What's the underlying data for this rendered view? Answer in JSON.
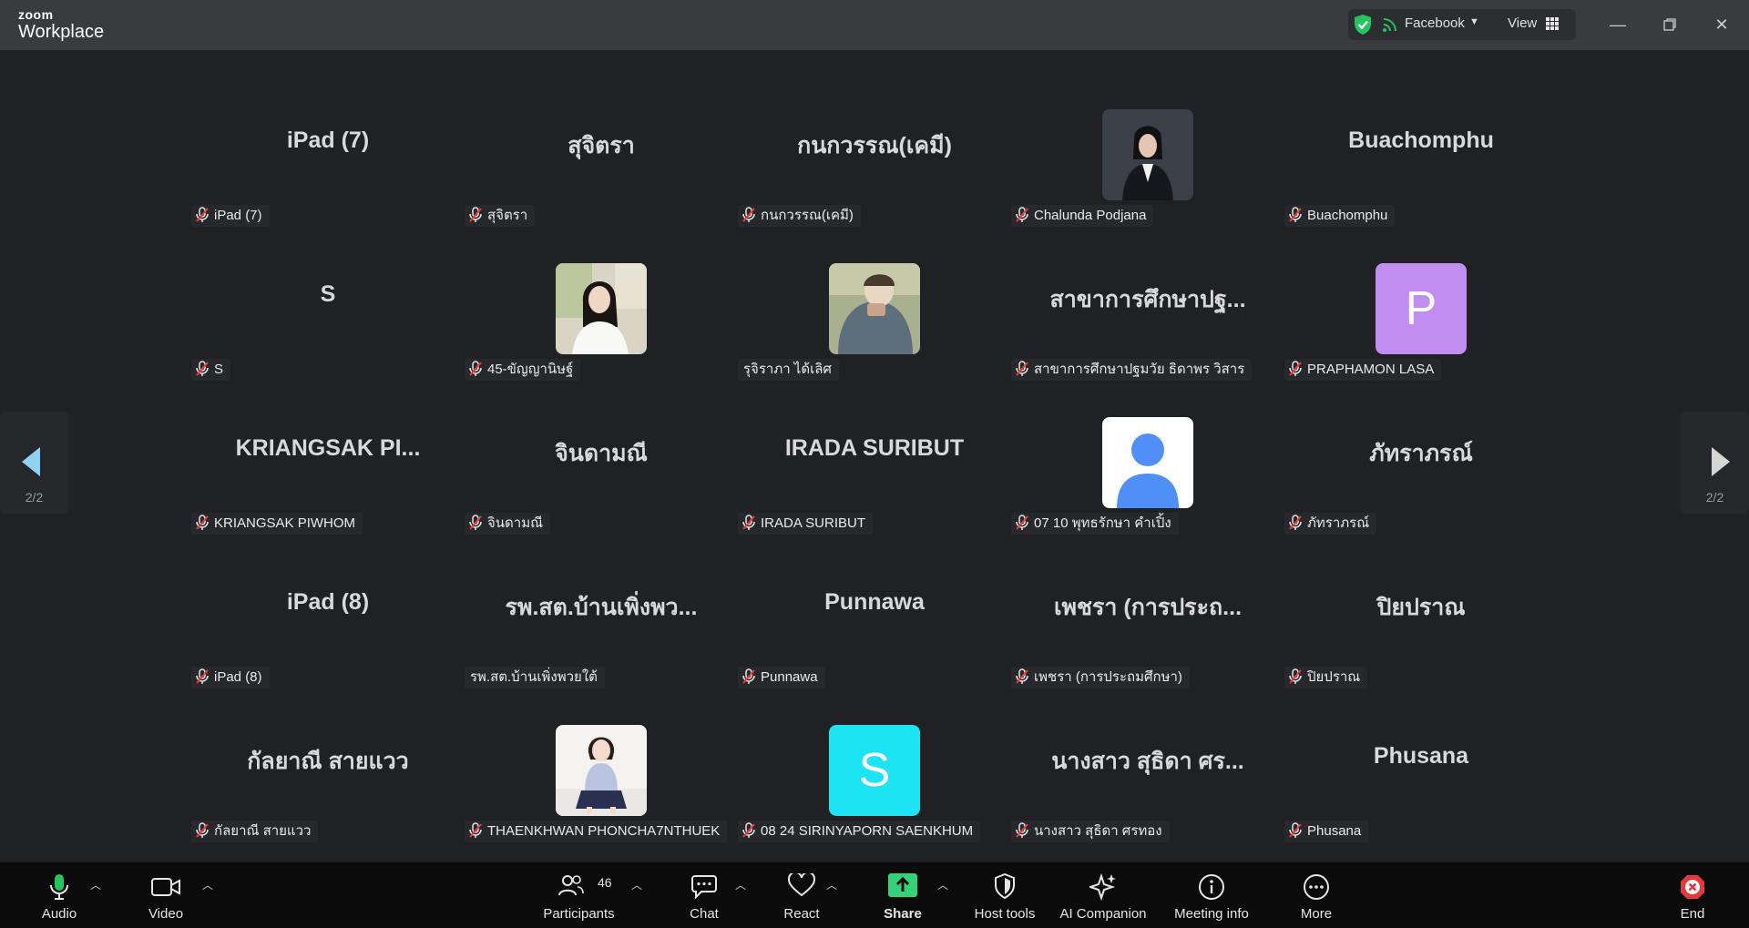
{
  "window": {
    "brand_small": "zoom",
    "brand_large": "Workplace",
    "share_source": "Facebook",
    "view_label": "View"
  },
  "gallery": {
    "page_indicator_left": "2/2",
    "page_indicator_right": "2/2",
    "tiles": [
      {
        "display": "iPad (7)",
        "label": "iPad (7)",
        "muted": true
      },
      {
        "display": "สุจิตรา",
        "label": "สุจิตรา",
        "muted": true
      },
      {
        "display": "กนกวรรณ(เคมี)",
        "label": "กนกวรรณ(เคมี)",
        "muted": true
      },
      {
        "display": "",
        "label": "Chalunda Podjana",
        "muted": true,
        "avatar": "photo-portrait-dark"
      },
      {
        "display": "Buachomphu",
        "label": "Buachomphu",
        "muted": true
      },
      {
        "display": "S",
        "label": "S",
        "muted": true
      },
      {
        "display": "",
        "label": "45-ขัญญานิษฐ์",
        "muted": true,
        "avatar": "photo-woman-white-shirt"
      },
      {
        "display": "",
        "label": "รุจิราภา ได้เลิศ",
        "muted": false,
        "avatar": "photo-person-outdoor"
      },
      {
        "display": "สาขาการศึกษาปฐ...",
        "label": "สาขาการศึกษาปฐมวัย ธิดาพร วิสาร",
        "muted": true
      },
      {
        "display": "",
        "label": "PRAPHAMON LASA",
        "muted": true,
        "avatar": "letter",
        "letter": "P",
        "avatar_color": "#c18df0"
      },
      {
        "display": "KRIANGSAK  PI...",
        "label": "KRIANGSAK PIWHOM",
        "muted": true
      },
      {
        "display": "จินดามณี",
        "label": "จินดามณี",
        "muted": true
      },
      {
        "display": "IRADA SURIBUT",
        "label": "IRADA SURIBUT",
        "muted": true
      },
      {
        "display": "",
        "label": "07 10 พุทธรักษา คำเปิ้ง",
        "muted": true,
        "avatar": "default-person"
      },
      {
        "display": "ภัทราภรณ์",
        "label": "ภัทราภรณ์",
        "muted": true
      },
      {
        "display": "iPad (8)",
        "label": "iPad (8)",
        "muted": true
      },
      {
        "display": "รพ.สต.บ้านเพิ่งพว...",
        "label": "รพ.สต.บ้านเพิ่งพวยใต้",
        "muted": false
      },
      {
        "display": "Punnawa",
        "label": "Punnawa",
        "muted": true
      },
      {
        "display": "เพชรา (การประถ...",
        "label": "เพชรา (การประถมศึกษา)",
        "muted": true
      },
      {
        "display": "ปิยปราณ",
        "label": "ปิยปราณ",
        "muted": true
      },
      {
        "display": "กัลยาณี สายแวว",
        "label": "กัลยาณี สายแวว",
        "muted": true
      },
      {
        "display": "",
        "label": "THAENKHWAN PHONCHA7NTHUEK",
        "muted": true,
        "avatar": "photo-girl-sitting"
      },
      {
        "display": "",
        "label": "08 24 SIRINYAPORN SAENKHUM",
        "muted": true,
        "avatar": "letter",
        "letter": "S",
        "avatar_color": "#1de4f2"
      },
      {
        "display": "นางสาว สุธิดา ศร...",
        "label": "นางสาว สุธิดา ศรทอง",
        "muted": true
      },
      {
        "display": "Phusana",
        "label": "Phusana",
        "muted": true
      }
    ]
  },
  "toolbar": {
    "audio": "Audio",
    "video": "Video",
    "participants": "Participants",
    "participants_count": "46",
    "chat": "Chat",
    "react": "React",
    "share": "Share",
    "host_tools": "Host tools",
    "ai_companion": "AI Companion",
    "meeting_info": "Meeting info",
    "more": "More",
    "end": "End",
    "share_color": "#33d17a",
    "end_color": "#e5383b",
    "mic_color": "#22c55e"
  }
}
